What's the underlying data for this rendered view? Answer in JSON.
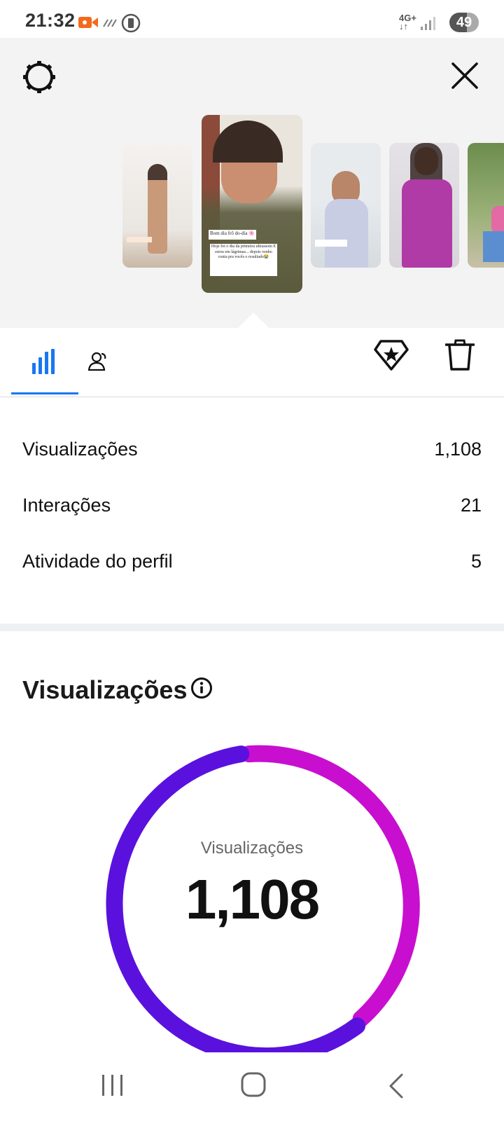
{
  "status_bar": {
    "time": "21:32",
    "network": "4G+",
    "battery": "49",
    "icons": [
      "video-camera-icon",
      "no-signal-icon",
      "vibrate-icon",
      "network-4g-icon",
      "signal-icon",
      "battery-icon"
    ],
    "accent_color": "#f26b1d"
  },
  "header": {
    "settings_icon": "gear-icon",
    "close_icon": "close-icon"
  },
  "stories": {
    "selected_caption_title": "Bom dia frô do-dia 🌸",
    "selected_caption_body": "Hoje foi o dia da primeira ultrassom E estou em lágrimas... depois venho conta pra vocês o resultado😭",
    "thumb1_caption": "",
    "thumb3_caption": ""
  },
  "tabs": {
    "items": [
      {
        "icon": "bar-chart-icon",
        "selected": true
      },
      {
        "icon": "people-icon",
        "selected": false
      }
    ],
    "actions": [
      {
        "icon": "star-badge-icon"
      },
      {
        "icon": "trash-icon"
      }
    ],
    "accent_color": "#1877f2"
  },
  "metrics": [
    {
      "label": "Visualizações",
      "value": "1,108"
    },
    {
      "label": "Interações",
      "value": "21"
    },
    {
      "label": "Atividade do perfil",
      "value": "5"
    }
  ],
  "views_section": {
    "title": "Visualizações",
    "info_icon": "info-icon",
    "center_label": "Visualizações",
    "center_value": "1,108",
    "ring_colors": [
      "#5a11de",
      "#c80fcf"
    ]
  },
  "nav": {
    "icons": [
      "recent-apps-icon",
      "home-icon",
      "back-icon"
    ]
  }
}
